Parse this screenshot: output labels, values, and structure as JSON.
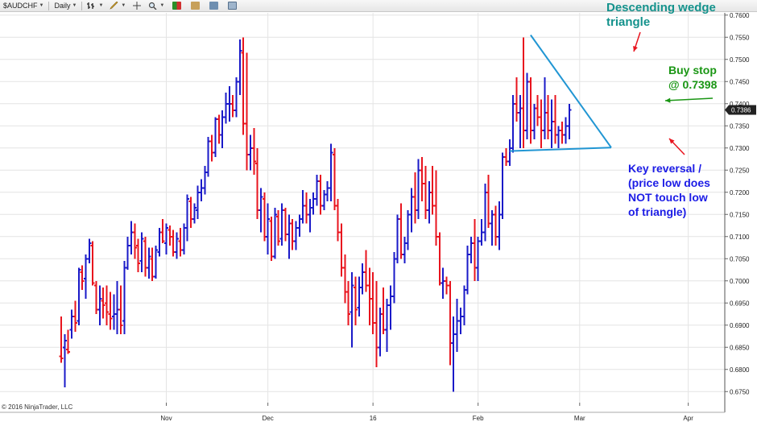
{
  "toolbar": {
    "instrument": "$AUDCHF",
    "period": "Daily"
  },
  "copyright": "© 2016 NinjaTrader, LLC",
  "colors": {
    "up_bar": "#1a1ac8",
    "down_bar": "#e8141e",
    "wedge_line": "#2196d3",
    "grid": "#e4e4e4",
    "title_annotation": "#14928c",
    "buy_annotation": "#1a9614",
    "reversal_annotation": "#1c1ce6",
    "price_marker": "#222222"
  },
  "chart_data": {
    "type": "ohlc",
    "title": "",
    "xlabel": "",
    "ylabel": "",
    "ylim": [
      0.6725,
      0.7605
    ],
    "y_ticks": [
      "0.7600",
      "0.7550",
      "0.7500",
      "0.7450",
      "0.7400",
      "0.7350",
      "0.7300",
      "0.7250",
      "0.7200",
      "0.7150",
      "0.7100",
      "0.7050",
      "0.7000",
      "0.6950",
      "0.6900",
      "0.6850",
      "0.6800",
      "0.6750"
    ],
    "x_ticks": [
      {
        "label": "Nov",
        "index": 30
      },
      {
        "label": "Dec",
        "index": 59
      },
      {
        "label": "16",
        "index": 89
      },
      {
        "label": "Feb",
        "index": 119
      },
      {
        "label": "Mar",
        "index": 148
      },
      {
        "label": "Apr",
        "index": 179
      }
    ],
    "bars": [
      [
        0.683,
        0.692,
        0.6815,
        0.6825
      ],
      [
        0.685,
        0.688,
        0.676,
        0.6865
      ],
      [
        0.6845,
        0.689,
        0.6835,
        0.684
      ],
      [
        0.689,
        0.6935,
        0.687,
        0.692
      ],
      [
        0.692,
        0.6955,
        0.6885,
        0.6905
      ],
      [
        0.691,
        0.703,
        0.69,
        0.7025
      ],
      [
        0.702,
        0.7035,
        0.698,
        0.7
      ],
      [
        0.7005,
        0.706,
        0.696,
        0.705
      ],
      [
        0.705,
        0.7095,
        0.704,
        0.7085
      ],
      [
        0.708,
        0.709,
        0.699,
        0.6995
      ],
      [
        0.699,
        0.7,
        0.6925,
        0.6935
      ],
      [
        0.6935,
        0.699,
        0.69,
        0.696
      ],
      [
        0.6955,
        0.6985,
        0.6915,
        0.6945
      ],
      [
        0.695,
        0.699,
        0.69,
        0.693
      ],
      [
        0.6925,
        0.6975,
        0.689,
        0.6915
      ],
      [
        0.692,
        0.697,
        0.689,
        0.6925
      ],
      [
        0.6925,
        0.7,
        0.688,
        0.6935
      ],
      [
        0.6935,
        0.699,
        0.688,
        0.69
      ],
      [
        0.691,
        0.7045,
        0.688,
        0.703
      ],
      [
        0.703,
        0.71,
        0.7025,
        0.708
      ],
      [
        0.708,
        0.7135,
        0.706,
        0.711
      ],
      [
        0.711,
        0.713,
        0.705,
        0.7075
      ],
      [
        0.708,
        0.7095,
        0.702,
        0.704
      ],
      [
        0.7045,
        0.711,
        0.702,
        0.7095
      ],
      [
        0.709,
        0.71,
        0.701,
        0.703
      ],
      [
        0.703,
        0.7075,
        0.7005,
        0.7055
      ],
      [
        0.705,
        0.7075,
        0.7,
        0.701
      ],
      [
        0.701,
        0.708,
        0.7005,
        0.707
      ],
      [
        0.7065,
        0.712,
        0.7055,
        0.711
      ],
      [
        0.711,
        0.714,
        0.7085,
        0.709
      ],
      [
        0.7085,
        0.713,
        0.706,
        0.712
      ],
      [
        0.7115,
        0.7125,
        0.708,
        0.71
      ],
      [
        0.71,
        0.7115,
        0.7055,
        0.7065
      ],
      [
        0.7065,
        0.711,
        0.705,
        0.7095
      ],
      [
        0.709,
        0.712,
        0.7055,
        0.707
      ],
      [
        0.707,
        0.713,
        0.706,
        0.712
      ],
      [
        0.712,
        0.7195,
        0.709,
        0.7185
      ],
      [
        0.718,
        0.719,
        0.712,
        0.714
      ],
      [
        0.714,
        0.7175,
        0.713,
        0.7165
      ],
      [
        0.716,
        0.7215,
        0.714,
        0.72
      ],
      [
        0.72,
        0.723,
        0.718,
        0.721
      ],
      [
        0.721,
        0.726,
        0.7195,
        0.7245
      ],
      [
        0.7245,
        0.7325,
        0.7235,
        0.7315
      ],
      [
        0.7315,
        0.733,
        0.727,
        0.729
      ],
      [
        0.729,
        0.737,
        0.728,
        0.7365
      ],
      [
        0.7365,
        0.7375,
        0.731,
        0.733
      ],
      [
        0.733,
        0.7385,
        0.73,
        0.737
      ],
      [
        0.737,
        0.7425,
        0.7355,
        0.74
      ],
      [
        0.74,
        0.744,
        0.736,
        0.74
      ],
      [
        0.74,
        0.742,
        0.737,
        0.7385
      ],
      [
        0.7385,
        0.746,
        0.737,
        0.745
      ],
      [
        0.745,
        0.7545,
        0.742,
        0.752
      ],
      [
        0.7515,
        0.755,
        0.733,
        0.7355
      ],
      [
        0.7355,
        0.7515,
        0.725,
        0.7285
      ],
      [
        0.7285,
        0.733,
        0.725,
        0.73
      ],
      [
        0.73,
        0.7345,
        0.724,
        0.727
      ],
      [
        0.7265,
        0.73,
        0.714,
        0.716
      ],
      [
        0.716,
        0.721,
        0.711,
        0.719
      ],
      [
        0.7185,
        0.72,
        0.709,
        0.71
      ],
      [
        0.71,
        0.7175,
        0.706,
        0.714
      ],
      [
        0.7135,
        0.7145,
        0.7045,
        0.7055
      ],
      [
        0.7055,
        0.7165,
        0.705,
        0.715
      ],
      [
        0.7145,
        0.716,
        0.708,
        0.709
      ],
      [
        0.7095,
        0.7175,
        0.708,
        0.716
      ],
      [
        0.716,
        0.7165,
        0.709,
        0.7105
      ],
      [
        0.7105,
        0.715,
        0.705,
        0.713
      ],
      [
        0.713,
        0.714,
        0.707,
        0.709
      ],
      [
        0.709,
        0.7135,
        0.707,
        0.712
      ],
      [
        0.712,
        0.715,
        0.71,
        0.714
      ],
      [
        0.714,
        0.7205,
        0.713,
        0.717
      ],
      [
        0.717,
        0.72,
        0.713,
        0.715
      ],
      [
        0.715,
        0.7185,
        0.711,
        0.7165
      ],
      [
        0.7165,
        0.72,
        0.715,
        0.7185
      ],
      [
        0.7185,
        0.724,
        0.717,
        0.7225
      ],
      [
        0.7225,
        0.724,
        0.715,
        0.717
      ],
      [
        0.717,
        0.7205,
        0.716,
        0.7195
      ],
      [
        0.7195,
        0.7225,
        0.718,
        0.721
      ],
      [
        0.721,
        0.731,
        0.718,
        0.729
      ],
      [
        0.7285,
        0.73,
        0.716,
        0.717
      ],
      [
        0.717,
        0.7185,
        0.709,
        0.711
      ],
      [
        0.711,
        0.713,
        0.701,
        0.703
      ],
      [
        0.703,
        0.706,
        0.695,
        0.6975
      ],
      [
        0.6975,
        0.7,
        0.69,
        0.6925
      ],
      [
        0.693,
        0.702,
        0.685,
        0.699
      ],
      [
        0.6985,
        0.701,
        0.69,
        0.6935
      ],
      [
        0.694,
        0.701,
        0.692,
        0.6985
      ],
      [
        0.6985,
        0.704,
        0.697,
        0.702
      ],
      [
        0.702,
        0.707,
        0.6975,
        0.699
      ],
      [
        0.699,
        0.703,
        0.69,
        0.696
      ],
      [
        0.696,
        0.702,
        0.688,
        0.6905
      ],
      [
        0.6905,
        0.7,
        0.6805,
        0.685
      ],
      [
        0.685,
        0.694,
        0.683,
        0.6925
      ],
      [
        0.6925,
        0.6985,
        0.688,
        0.689
      ],
      [
        0.689,
        0.696,
        0.684,
        0.6945
      ],
      [
        0.6945,
        0.699,
        0.689,
        0.6965
      ],
      [
        0.6965,
        0.7065,
        0.695,
        0.705
      ],
      [
        0.705,
        0.715,
        0.704,
        0.714
      ],
      [
        0.714,
        0.7175,
        0.705,
        0.706
      ],
      [
        0.706,
        0.71,
        0.704,
        0.7085
      ],
      [
        0.7085,
        0.716,
        0.707,
        0.715
      ],
      [
        0.715,
        0.721,
        0.711,
        0.719
      ],
      [
        0.719,
        0.7245,
        0.713,
        0.716
      ],
      [
        0.716,
        0.7275,
        0.714,
        0.725
      ],
      [
        0.725,
        0.728,
        0.718,
        0.722
      ],
      [
        0.722,
        0.726,
        0.714,
        0.716
      ],
      [
        0.716,
        0.7225,
        0.713,
        0.72
      ],
      [
        0.72,
        0.726,
        0.715,
        0.717
      ],
      [
        0.717,
        0.725,
        0.708,
        0.71
      ],
      [
        0.71,
        0.711,
        0.699,
        0.6995
      ],
      [
        0.6995,
        0.703,
        0.696,
        0.7
      ],
      [
        0.7,
        0.701,
        0.697,
        0.699
      ],
      [
        0.699,
        0.7,
        0.681,
        0.686
      ],
      [
        0.686,
        0.692,
        0.675,
        0.688
      ],
      [
        0.688,
        0.696,
        0.684,
        0.691
      ],
      [
        0.691,
        0.694,
        0.688,
        0.692
      ],
      [
        0.692,
        0.699,
        0.69,
        0.698
      ],
      [
        0.698,
        0.708,
        0.697,
        0.706
      ],
      [
        0.706,
        0.71,
        0.704,
        0.7085
      ],
      [
        0.7085,
        0.714,
        0.7,
        0.703
      ],
      [
        0.703,
        0.71,
        0.7,
        0.709
      ],
      [
        0.709,
        0.714,
        0.708,
        0.711
      ],
      [
        0.711,
        0.722,
        0.709,
        0.72
      ],
      [
        0.72,
        0.724,
        0.712,
        0.713
      ],
      [
        0.713,
        0.716,
        0.708,
        0.715
      ],
      [
        0.715,
        0.717,
        0.708,
        0.71
      ],
      [
        0.71,
        0.718,
        0.707,
        0.715
      ],
      [
        0.715,
        0.729,
        0.714,
        0.728
      ],
      [
        0.728,
        0.73,
        0.726,
        0.727
      ],
      [
        0.727,
        0.732,
        0.726,
        0.73
      ],
      [
        0.73,
        0.742,
        0.729,
        0.74
      ],
      [
        0.74,
        0.746,
        0.736,
        0.738
      ],
      [
        0.738,
        0.742,
        0.73,
        0.739
      ],
      [
        0.739,
        0.755,
        0.73,
        0.734
      ],
      [
        0.734,
        0.747,
        0.732,
        0.745
      ],
      [
        0.745,
        0.746,
        0.731,
        0.734
      ],
      [
        0.734,
        0.74,
        0.732,
        0.739
      ],
      [
        0.739,
        0.742,
        0.735,
        0.737
      ],
      [
        0.737,
        0.741,
        0.73,
        0.734
      ],
      [
        0.734,
        0.746,
        0.732,
        0.738
      ],
      [
        0.738,
        0.742,
        0.732,
        0.734
      ],
      [
        0.734,
        0.741,
        0.73,
        0.736
      ],
      [
        0.736,
        0.742,
        0.731,
        0.733
      ],
      [
        0.733,
        0.735,
        0.73,
        0.734
      ],
      [
        0.734,
        0.736,
        0.731,
        0.733
      ],
      [
        0.733,
        0.737,
        0.731,
        0.735
      ],
      [
        0.735,
        0.74,
        0.732,
        0.7386
      ]
    ],
    "wedge_lines": [
      {
        "from": {
          "index": 134,
          "price": 0.7555
        },
        "to": {
          "index": 157,
          "price": 0.7301
        }
      },
      {
        "from": {
          "index": 128,
          "price": 0.7293
        },
        "to": {
          "index": 157,
          "price": 0.7301
        }
      }
    ],
    "last_price": "0.7386",
    "annotations": [
      {
        "text": "Descending wedge triangle",
        "lines": [
          "Descending wedge",
          "triangle"
        ],
        "color_key": "title_annotation"
      },
      {
        "text": "Buy stop @ 0.7398",
        "lines": [
          "Buy stop",
          "@ 0.7398"
        ],
        "color_key": "buy_annotation"
      },
      {
        "text": "Key reversal / (price low does NOT touch low of triangle)",
        "lines": [
          "Key reversal  /",
          "(price low does",
          "NOT touch low",
          "of triangle)"
        ],
        "color_key": "reversal_annotation"
      }
    ]
  }
}
